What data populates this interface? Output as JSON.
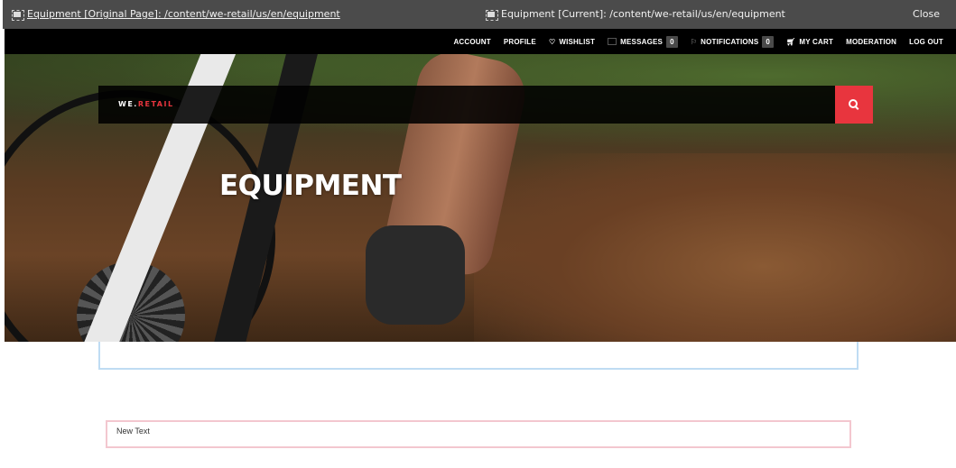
{
  "compare_bar": {
    "original_label": "Equipment [Original Page]: /content/we-retail/us/en/equipment",
    "current_label": "Equipment [Current]: /content/we-retail/us/en/equipment",
    "close_label": "Close",
    "background": "#4b4b4b"
  },
  "nav": {
    "account": "ACCOUNT",
    "profile": "PROFILE",
    "wishlist": "WISHLIST",
    "messages": "MESSAGES",
    "messages_count": "0",
    "notifications": "NOTIFICATIONS",
    "notifications_count": "0",
    "cart": "MY CART",
    "moderation": "MODERATION",
    "logout": "LOG OUT"
  },
  "hero": {
    "brand_prefix": "WE.",
    "brand_suffix": "RETAIL",
    "title": "EQUIPMENT"
  },
  "components": {
    "text_component": "New Text"
  },
  "colors": {
    "accent": "#e8353e",
    "nav_bg": "#000000",
    "blue_frame": "#bfdcf3",
    "pink_frame": "#f3c7cf"
  },
  "icons": {
    "compare_icon": "page-compare-icon",
    "wishlist_icon": "heart-icon",
    "messages_icon": "envelope-icon",
    "notifications_icon": "flag-icon",
    "cart_icon": "cart-icon",
    "search_icon": "search-icon"
  }
}
